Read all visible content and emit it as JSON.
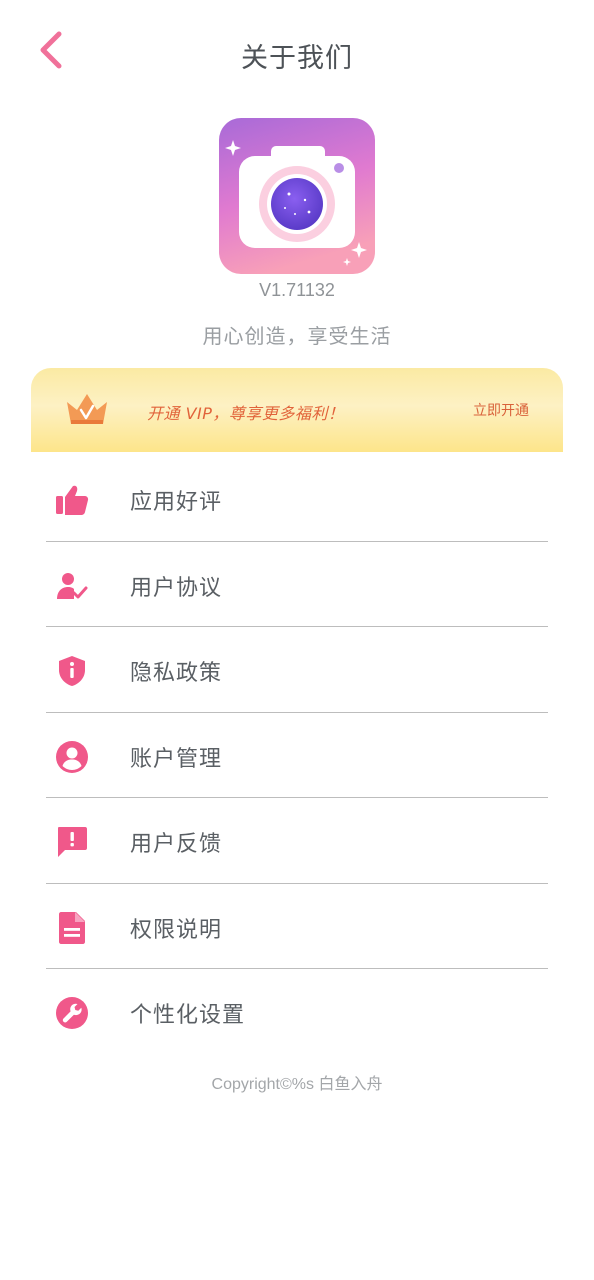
{
  "header": {
    "title": "关于我们",
    "back_icon": "chevron-left-icon"
  },
  "app": {
    "icon": "camera-app-icon",
    "version": "V1.71132",
    "slogan": "用心创造，享受生活"
  },
  "vip": {
    "icon": "crown-icon",
    "text": "开通 VIP，尊享更多福利！",
    "action": "立即开通"
  },
  "menu": {
    "items": [
      {
        "label": "应用好评",
        "icon": "thumbs-up-icon"
      },
      {
        "label": "用户协议",
        "icon": "user-check-icon"
      },
      {
        "label": "隐私政策",
        "icon": "shield-info-icon"
      },
      {
        "label": "账户管理",
        "icon": "account-circle-icon"
      },
      {
        "label": "用户反馈",
        "icon": "feedback-icon"
      },
      {
        "label": "权限说明",
        "icon": "document-icon"
      },
      {
        "label": "个性化设置",
        "icon": "wrench-icon"
      }
    ]
  },
  "footer": {
    "copyright": "Copyright©%s 白鱼入舟"
  },
  "colors": {
    "accent": "#f0588a",
    "vip_text": "#e1633a",
    "divider": "#bdbdbd"
  }
}
